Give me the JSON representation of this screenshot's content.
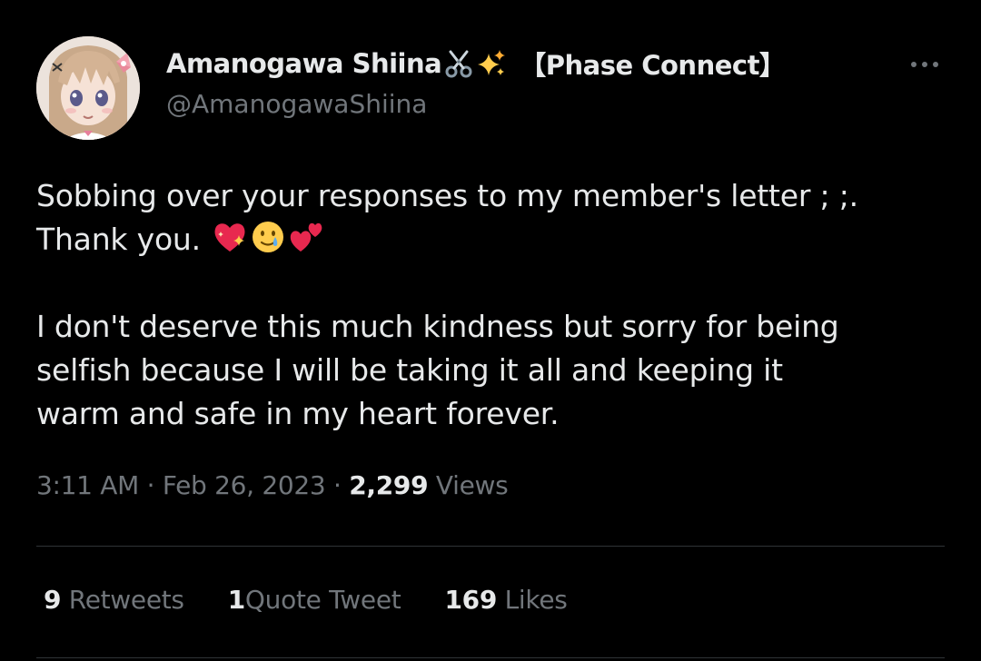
{
  "tweet": {
    "author": {
      "display_name": "Amanogawa Shiina",
      "name_emojis": [
        "scissors-icon",
        "sparkles-icon"
      ],
      "affiliation": "【Phase Connect】",
      "handle": "@AmanogawaShiina"
    },
    "body": {
      "line1": "Sobbing over your responses to my member's letter ; ;.",
      "line2": "Thank you.",
      "line2_emojis": [
        "sparkling-heart-icon",
        "smiling-face-with-tear-icon",
        "two-hearts-icon"
      ],
      "paragraph2": [
        "I don't deserve this much kindness but sorry for being",
        "selfish because I will be taking it all and keeping it",
        "warm and safe in my heart forever."
      ]
    },
    "meta": {
      "time": "3:11 AM",
      "separator": "·",
      "date": "Feb 26, 2023",
      "views_count": "2,299",
      "views_label": "Views"
    },
    "stats": {
      "retweets_count": "9",
      "retweets_label": "Retweets",
      "quotes_count": "1",
      "quotes_label": "Quote Tweet",
      "likes_count": "169",
      "likes_label": "Likes"
    }
  },
  "colors": {
    "background": "#000000",
    "primary_text": "#e7e9ea",
    "secondary_text": "#71767b",
    "divider": "#2f3336"
  }
}
